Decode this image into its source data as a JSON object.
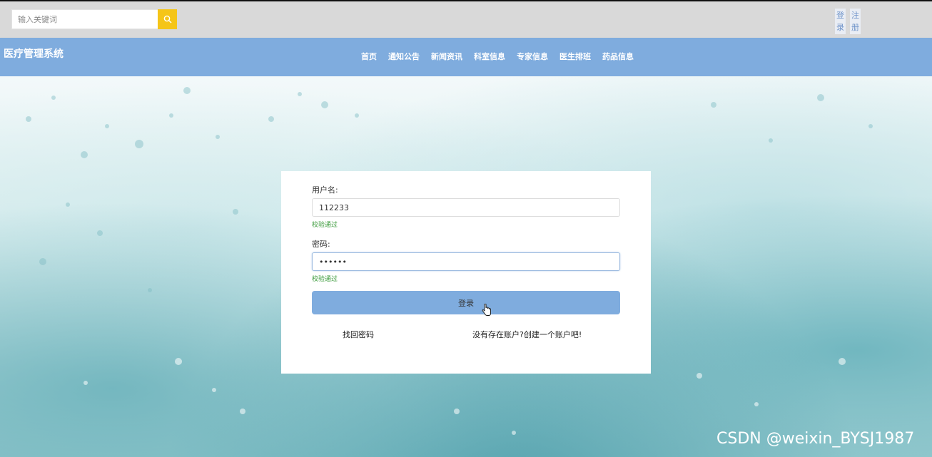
{
  "search": {
    "placeholder": "输入关键词"
  },
  "auth": {
    "login": "登录",
    "register": "注册"
  },
  "brand": "医疗管理系统",
  "nav": [
    "首页",
    "通知公告",
    "新闻资讯",
    "科室信息",
    "专家信息",
    "医生排班",
    "药品信息"
  ],
  "form": {
    "username_label": "用户名:",
    "username_value": "112233",
    "username_status": "校验通过",
    "password_label": "密码:",
    "password_value": "••••••",
    "password_status": "校验通过",
    "submit_label": "登录",
    "forgot_link": "找回密码",
    "register_link": "没有存在账户?创建一个账户吧!"
  },
  "watermark": "CSDN @weixin_BYSJ1987",
  "colors": {
    "primary": "#7facde",
    "search_button": "#f5c518",
    "success": "#3a9a3a"
  }
}
